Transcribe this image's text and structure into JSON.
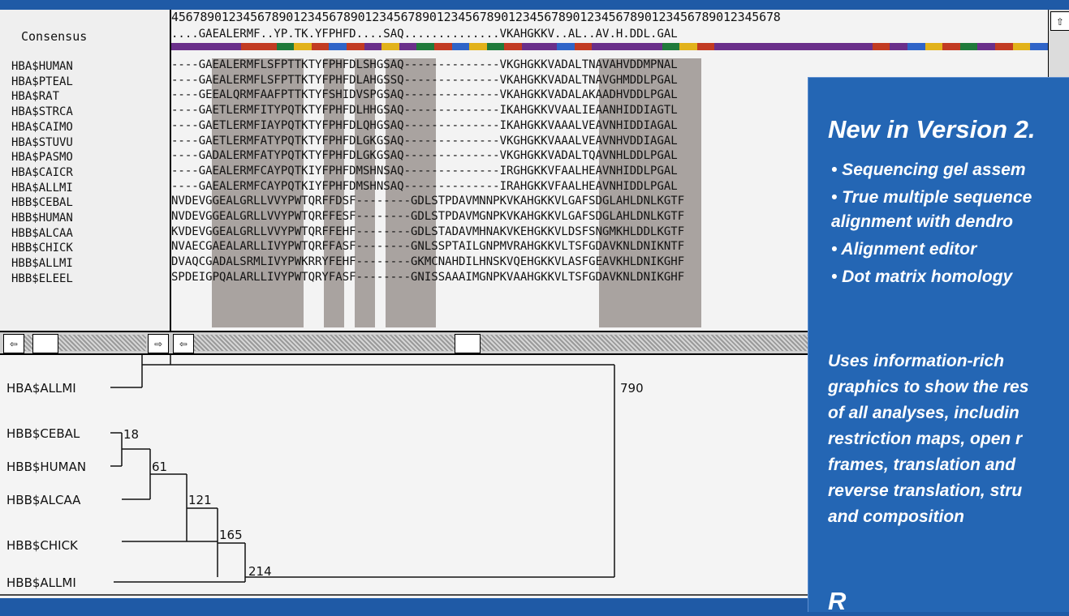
{
  "ruler": "4567890123456789012345678901234567890123456789012345678901234567890123456789012345678",
  "names_header": "Consensus",
  "consensus_line": "....GAEALERMF..YP.TK.YFPHFD....SAQ..............VKAHGKKV..AL..AV.H.DDL.GAL",
  "sequences": [
    {
      "name": "HBA$HUMAN",
      "seq": "----GAEALERMFLSFPTTKTYFPHFDLSHGSAQ--------------VKGHGKKVADALTNAVAHVDDMPNAL"
    },
    {
      "name": "HBA$PTEAL",
      "seq": "----GAEALERMFLSFPTTKTYFPHFDLAHGSSQ--------------VKAHGKKVADALTNAVGHMDDLPGAL"
    },
    {
      "name": "HBA$RAT",
      "seq": "----GEEALQRMFAAFPTTKTYFSHIDVSPGSAQ--------------VKAHGKKVADALAKAADHVDDLPGAL"
    },
    {
      "name": "HBA$STRCA",
      "seq": "----GAETLERMFITYPQTKTYFPHFDLHHGSAQ--------------IKAHGKKVVAALIEAANHIDDIAGTL"
    },
    {
      "name": "HBA$CAIMO",
      "seq": "----GAETLERMFIAYPQTKTYFPHFDLQHGSAQ--------------IKAHGKKVAAALVEAVNHIDDIAGAL"
    },
    {
      "name": "HBA$STUVU",
      "seq": "----GAETLERMFATYPQTKTYFPHFDLGKGSAQ--------------VKGHGKKVAAALVEAVNHVDDIAGAL"
    },
    {
      "name": "HBA$PASMO",
      "seq": "----GADALERMFATYPQTKTYFPHFDLGKGSAQ--------------VKGHGKKVADALTQAVNHLDDLPGAL"
    },
    {
      "name": "HBA$CAICR",
      "seq": "----GAEALERMFCAYPQTKIYFPHFDMSHNSAQ--------------IRGHGKKVFAALHEAVNHIDDLPGAL"
    },
    {
      "name": "HBA$ALLMI",
      "seq": "----GAEALERMFCAYPQTKIYFPHFDMSHNSAQ--------------IRAHGKKVFAALHEAVNHIDDLPGAL"
    },
    {
      "name": "HBB$CEBAL",
      "seq": "NVDEVGGEALGRLLVVYPWTQRFFDSF--------GDLSTPDAVMNNPKVKAHGKKVLGAFSDGLAHLDNLKGTF"
    },
    {
      "name": "HBB$HUMAN",
      "seq": "NVDEVGGEALGRLLVVYPWTQRFFESF--------GDLSTPDAVMGNPKVKAHGKKVLGAFSDGLAHLDNLKGTF"
    },
    {
      "name": "HBB$ALCAA",
      "seq": "KVDEVGGEALGRLLVVYPWTQRFFEHF--------GDLSTADAVMHNAKVKEHGKKVLDSFSNGMKHLDDLKGTF"
    },
    {
      "name": "HBB$CHICK",
      "seq": "NVAECGAEALARLLIVYPWTQRFFASF--------GNLSSPTAILGNPMVRAHGKKVLTSFGDAVKNLDNIKNTF"
    },
    {
      "name": "HBB$ALLMI",
      "seq": "DVAQCGADALSRMLIVYPWKRRYFEHF--------GKMCNAHDILHNSKVQEHGKKVLASFGEAVKHLDNIKGHF"
    },
    {
      "name": "HBB$ELEEL",
      "seq": "SPDEIGPQALARLLIVYPWTQRYFASF--------GNISSAAAIMGNPKVAAHGKKVLTSFGDAVKNLDNIKGHF"
    }
  ],
  "tree": {
    "leaves": [
      "HBA$ALLMI",
      "HBB$CEBAL",
      "HBB$HUMAN",
      "HBB$ALCAA",
      "HBB$CHICK",
      "HBB$ALLMI"
    ],
    "distances": [
      "790",
      "18",
      "61",
      "121",
      "165",
      "214"
    ]
  },
  "promo": {
    "title": "New in Version 2.",
    "bullets": [
      "• Sequencing gel assem",
      "• True multiple sequence",
      "  alignment with dendro",
      "• Alignment editor",
      "• Dot matrix homology"
    ],
    "para": [
      "Uses information-rich",
      "graphics to show the res",
      "of all analyses, includin",
      "restriction maps, open r",
      "frames, translation and",
      "reverse translation, stru",
      "and composition"
    ],
    "footer": "R"
  },
  "scroll": {
    "up": "⇧",
    "left": "⇦",
    "right": "⇨"
  },
  "colors": {
    "shade": "#a9a3a0",
    "panel": "#2466b4",
    "bg": "#1f5aa6"
  }
}
